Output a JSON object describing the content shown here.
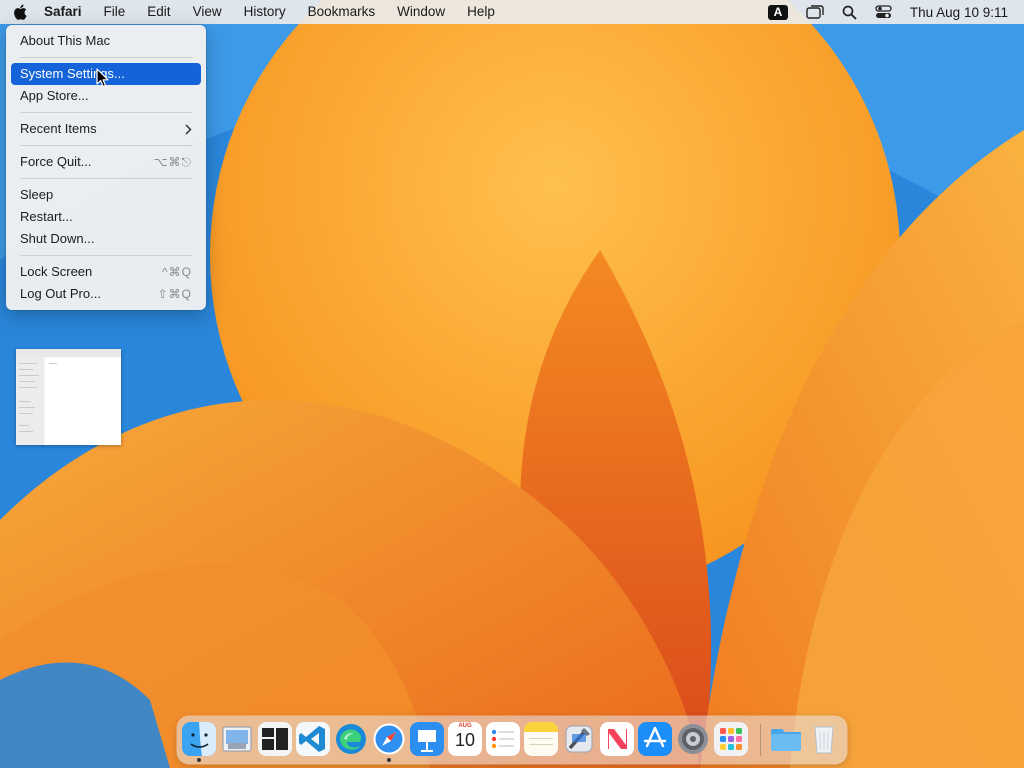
{
  "menubar": {
    "app_name": "Safari",
    "menus": [
      "File",
      "Edit",
      "View",
      "History",
      "Bookmarks",
      "Window",
      "Help"
    ],
    "input_source": "A",
    "clock": "Thu Aug 10  9:11"
  },
  "apple_menu": {
    "about": "About This Mac",
    "system_settings": "System Settings...",
    "app_store": "App Store...",
    "recent_items": "Recent Items",
    "force_quit": "Force Quit...",
    "force_quit_shortcut": "⌥⌘⎋",
    "sleep": "Sleep",
    "restart": "Restart...",
    "shut_down": "Shut Down...",
    "lock_screen": "Lock Screen",
    "lock_screen_shortcut": "^⌘Q",
    "log_out": "Log Out Pro...",
    "log_out_shortcut": "⇧⌘Q"
  },
  "dock": {
    "calendar_month": "AUG",
    "calendar_day": "10",
    "apps": [
      "finder-icon",
      "preview-icon",
      "window-manager-icon",
      "vscode-icon",
      "edge-icon",
      "safari-icon",
      "keynote-icon",
      "calendar-icon",
      "reminders-icon",
      "notes-icon",
      "xcode-icon",
      "news-icon",
      "app-store-icon",
      "system-settings-icon",
      "launchpad-icon",
      "downloads-folder-icon",
      "trash-icon"
    ]
  },
  "colors": {
    "selection": "#1563d8",
    "menubar": "#ececec"
  }
}
